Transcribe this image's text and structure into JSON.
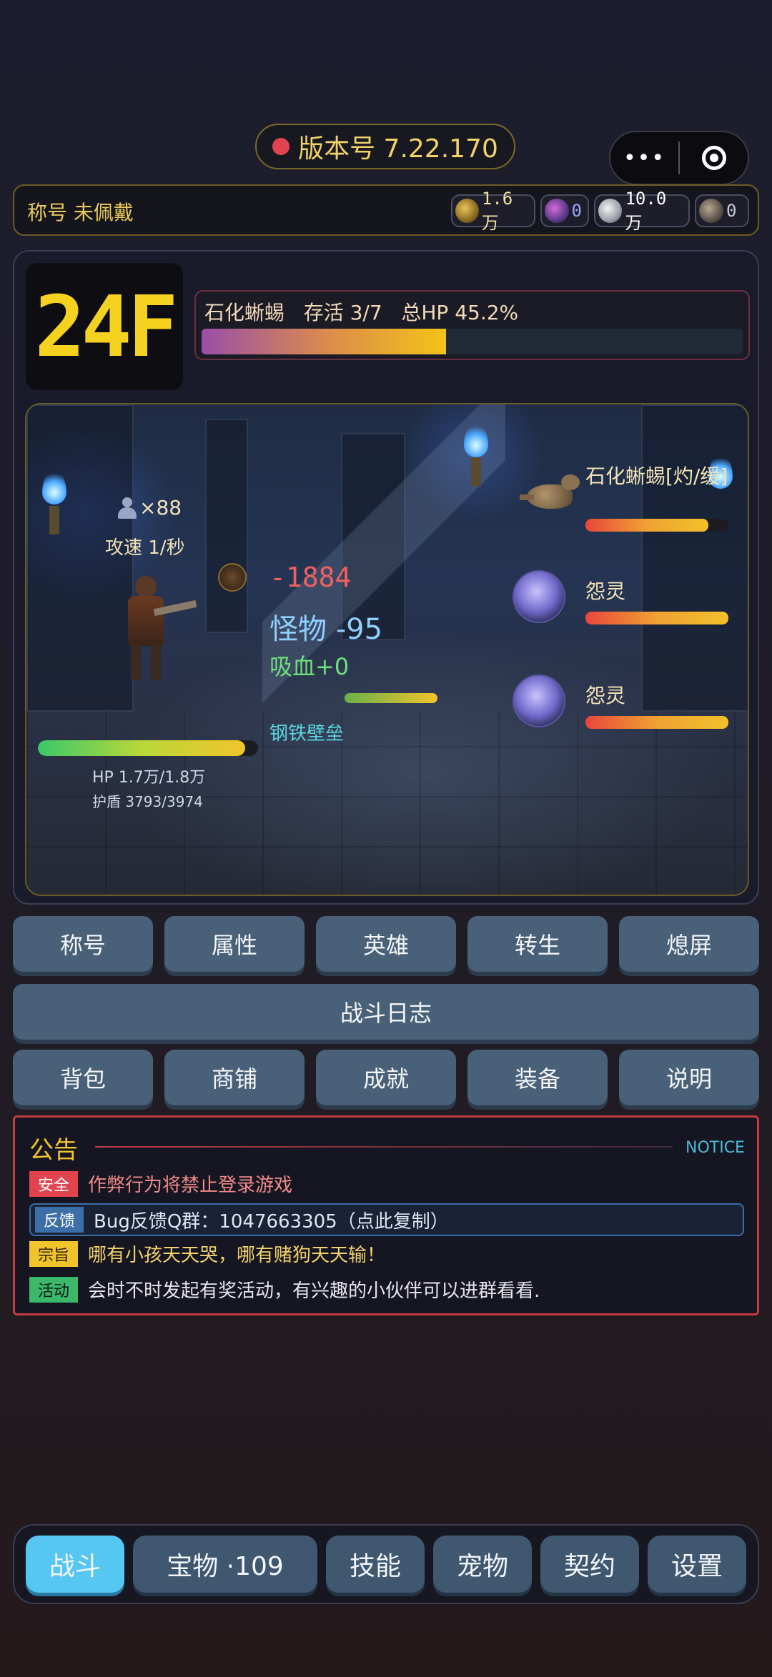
{
  "version": {
    "label": "版本号 7.22.170"
  },
  "capsule": {
    "more": "•••"
  },
  "title_bar": {
    "title": "称号 未佩戴",
    "currencies": [
      {
        "icon": "gold-coin-icon",
        "value": "1.6万"
      },
      {
        "icon": "purple-gem-icon",
        "value": "0"
      },
      {
        "icon": "silver-drop-icon",
        "value": "10.0万"
      },
      {
        "icon": "stone-orb-icon",
        "value": "0"
      }
    ]
  },
  "floor": {
    "label": "24F"
  },
  "wave": {
    "text": "石化蜥蜴   存活 3/7   总HP 45.2%",
    "hp_percent": 45.2
  },
  "battle": {
    "hero": {
      "level": "×88",
      "attack_speed": "攻速 1/秒",
      "hp": "HP 1.7万/1.8万",
      "shield": "护盾 3793/3974",
      "hp_ratio": 0.94,
      "shield_ratio": 0.95
    },
    "floating": {
      "damage": "-1884",
      "monster_hit": "怪物 -95",
      "lifesteal": "吸血+0",
      "skill": "钢铁壁垒",
      "skill_progress": 1.0
    },
    "monsters": [
      {
        "name": "石化蜥蜴[灼/缓]",
        "hp_ratio": 0.86
      },
      {
        "name": "怨灵",
        "hp_ratio": 1.0
      },
      {
        "name": "怨灵",
        "hp_ratio": 1.0
      }
    ]
  },
  "buttons_row1": [
    "称号",
    "属性",
    "英雄",
    "转生",
    "熄屏"
  ],
  "battle_log": "战斗日志",
  "buttons_row2": [
    "背包",
    "商铺",
    "成就",
    "装备",
    "说明"
  ],
  "notice": {
    "title": "公告",
    "title_en": "NOTICE",
    "items": [
      {
        "tag": "安全",
        "text": "作弊行为将禁止登录游戏",
        "color": "#e2444f"
      },
      {
        "tag": "反馈",
        "text": "Bug反馈Q群：1047663305（点此复制）",
        "color": "#3c6ea8"
      },
      {
        "tag": "宗旨",
        "text": "哪有小孩天天哭，哪有赌狗天天输！",
        "color": "#f2c42b"
      },
      {
        "tag": "活动",
        "text": "会时不时发起有奖活动，有兴趣的小伙伴可以进群看看.",
        "color": "#3bb86a"
      }
    ]
  },
  "nav": [
    {
      "label": "战斗",
      "active": true
    },
    {
      "label": "宝物 ·109",
      "active": false
    },
    {
      "label": "技能",
      "active": false
    },
    {
      "label": "宠物",
      "active": false
    },
    {
      "label": "契约",
      "active": false
    },
    {
      "label": "设置",
      "active": false
    }
  ],
  "colors": {
    "accent_gold": "#f5d21f",
    "active_tab": "#56c6f2",
    "danger": "#e2444f"
  }
}
